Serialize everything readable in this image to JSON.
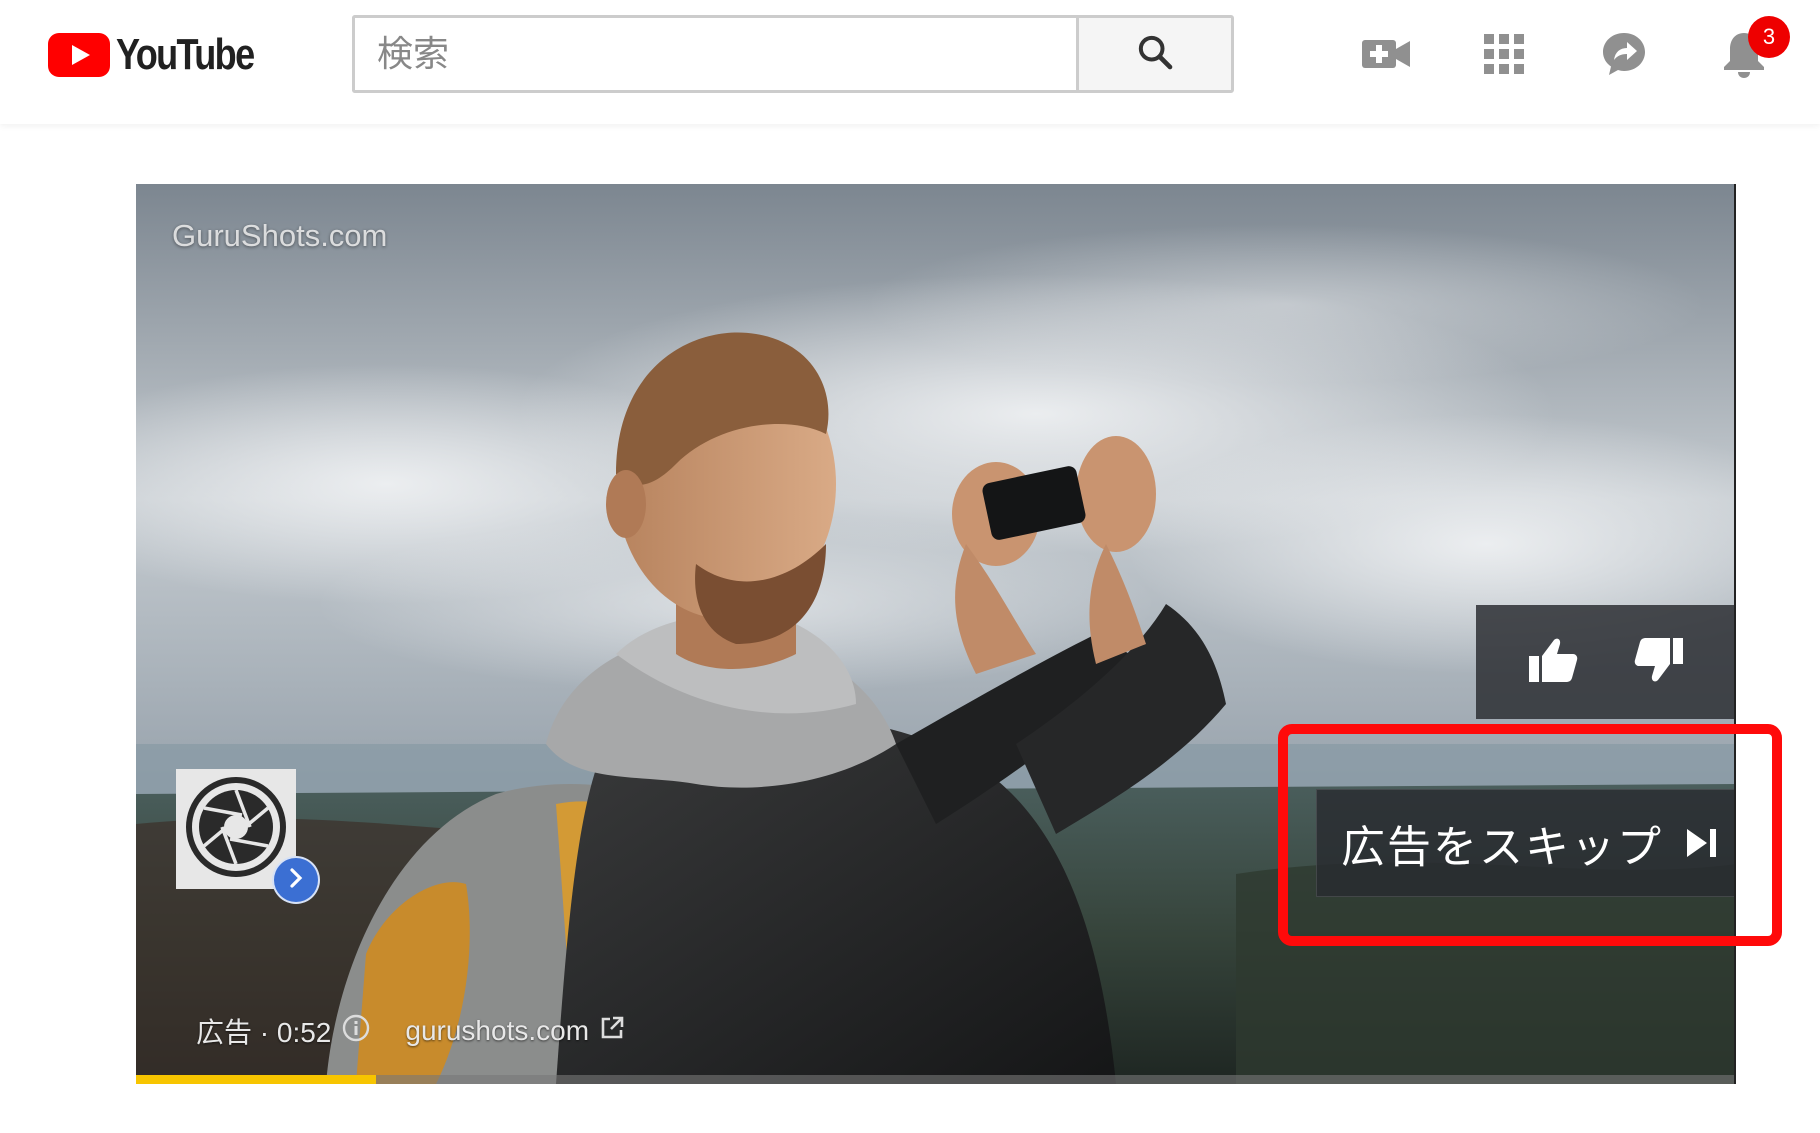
{
  "masthead": {
    "logo_text": "YouTube",
    "search": {
      "placeholder": "検索",
      "value": ""
    },
    "icons": [
      "upload-video-icon",
      "apps-grid-icon",
      "messages-icon",
      "notifications-bell-icon"
    ],
    "notifications_count": "3"
  },
  "player": {
    "watermark": "GuruShots.com",
    "skip_button_label": "広告をスキップ",
    "ad_label": "広告 · 0:52",
    "ad_url": "gurushots.com",
    "progress": 0.15,
    "colors": {
      "progress": "#f7c500",
      "highlight": "#ff0a0a",
      "brand_red": "#ff0000"
    }
  }
}
